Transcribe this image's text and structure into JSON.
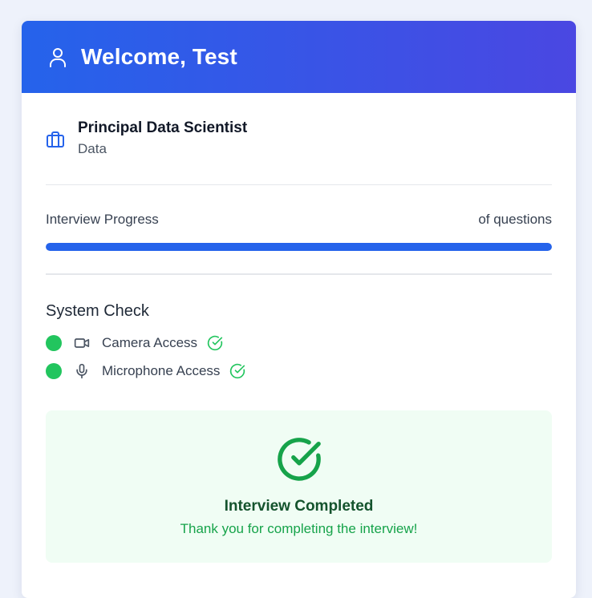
{
  "header": {
    "title": "Welcome, Test",
    "icon": "user-icon"
  },
  "role": {
    "icon": "briefcase-icon",
    "title": "Principal Data Scientist",
    "department": "Data"
  },
  "progress": {
    "label": "Interview Progress",
    "count_text": "of questions",
    "fraction": 1.0
  },
  "system_check": {
    "title": "System Check",
    "items": [
      {
        "label": "Camera Access",
        "icon": "camera-icon",
        "status": "ok"
      },
      {
        "label": "Microphone Access",
        "icon": "microphone-icon",
        "status": "ok"
      }
    ]
  },
  "completion": {
    "icon": "check-circle-icon",
    "title": "Interview Completed",
    "message": "Thank you for completing the interview!"
  },
  "colors": {
    "header_start": "#2563eb",
    "header_end": "#4a47e2",
    "accent": "#2563eb",
    "success": "#22c55e",
    "success_dark": "#16a34a",
    "success_bg": "#f0fdf4"
  }
}
